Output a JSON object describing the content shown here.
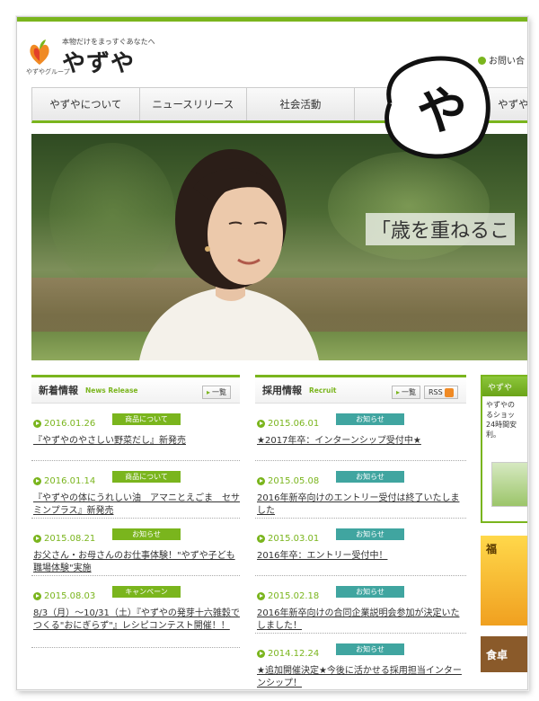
{
  "header": {
    "slogan": "本物だけをまっすぐあなたへ",
    "brand": "やずや",
    "brand_group": "やずやグループ",
    "contact": "お問い合"
  },
  "hand_drawn_char": "や",
  "nav": {
    "items": [
      {
        "label": "やずやについて"
      },
      {
        "label": "ニュースリリース"
      },
      {
        "label": "社会活動"
      },
      {
        "label": ""
      },
      {
        "label": "やずや"
      }
    ]
  },
  "hero": {
    "quote": "「歳を重ねるこ"
  },
  "news": {
    "title": "新着情報",
    "subtitle": "News Release",
    "list_button": "一覧",
    "items": [
      {
        "date": "2016.01.26",
        "tag": "商品について",
        "text": "『やずやのやさしい野菜だし』新発売"
      },
      {
        "date": "2016.01.14",
        "tag": "商品について",
        "text": "『やずやの体にうれしい油　アマニとえごま　セサミンプラス』新発売"
      },
      {
        "date": "2015.08.21",
        "tag": "お知らせ",
        "text": "お父さん・お母さんのお仕事体験！\"やずや子ども職場体験\"実施"
      },
      {
        "date": "2015.08.03",
        "tag": "キャンペーン",
        "text": "8/3（月）～10/31（土）『やずやの発芽十六雑穀でつくる\"おにぎらず\"』レシピコンテスト開催！！"
      }
    ]
  },
  "recruit": {
    "title": "採用情報",
    "subtitle": "Recruit",
    "list_button": "一覧",
    "rss_label": "RSS",
    "items": [
      {
        "date": "2015.06.01",
        "tag": "お知らせ",
        "text": "★2017年卒：インターンシップ受付中★"
      },
      {
        "date": "2015.05.08",
        "tag": "お知らせ",
        "text": "2016年新卒向けのエントリー受付は終了いたしました"
      },
      {
        "date": "2015.03.01",
        "tag": "お知らせ",
        "text": "2016年卒：エントリー受付中！"
      },
      {
        "date": "2015.02.18",
        "tag": "お知らせ",
        "text": "2016年新卒向けの合同企業説明会参加が決定いたしました！"
      },
      {
        "date": "2014.12.24",
        "tag": "お知らせ",
        "text": "★追加開催決定★今後に活かせる採用担当インターンシップ！"
      }
    ]
  },
  "side": {
    "head": "やずや",
    "text": "やずやの\nるショッ\n24時間安\n利。",
    "banner1": "福",
    "banner2": "食卓"
  }
}
